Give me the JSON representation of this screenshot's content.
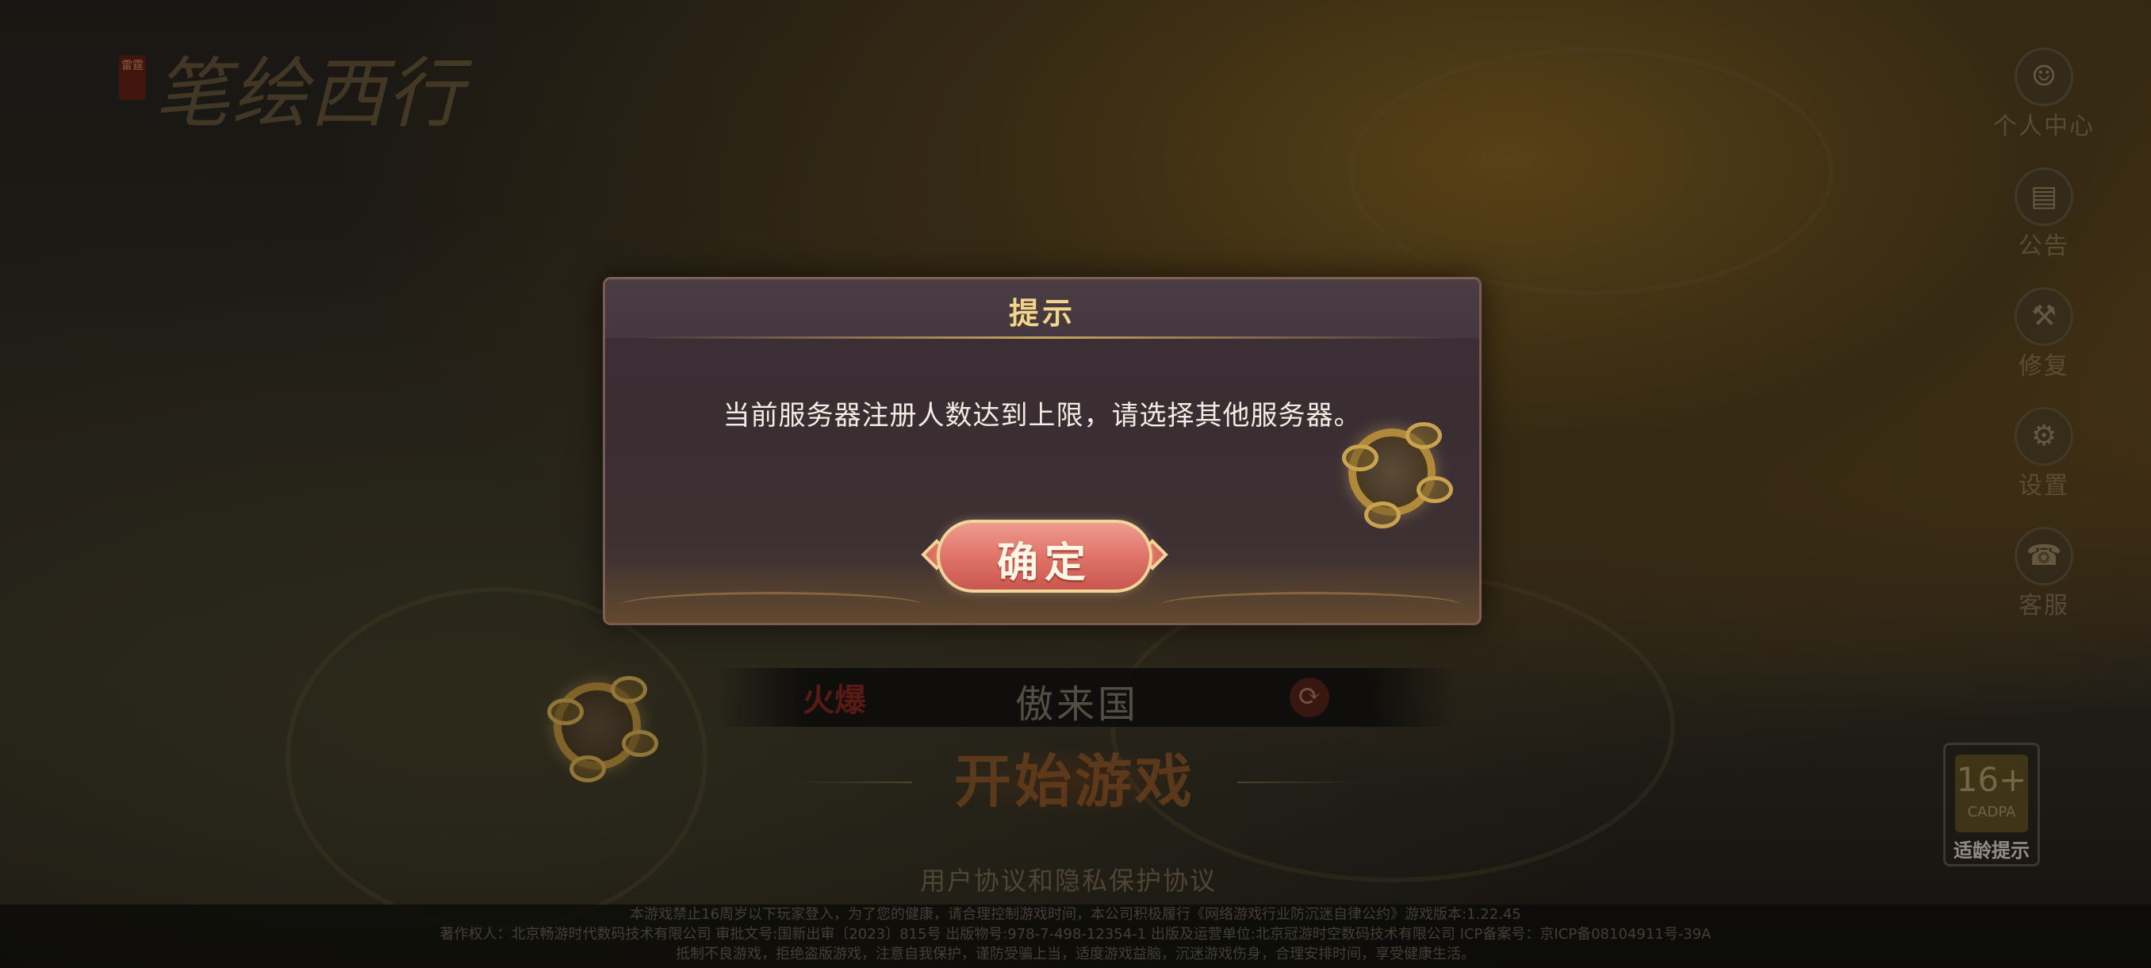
{
  "game": {
    "logo_seal": "雷霆",
    "logo_title": "笔绘西行"
  },
  "sidebar": {
    "items": [
      {
        "label": "个人中心",
        "icon": "user-icon",
        "glyph": "☺"
      },
      {
        "label": "公告",
        "icon": "notice-icon",
        "glyph": "▤"
      },
      {
        "label": "修复",
        "icon": "repair-icon",
        "glyph": "⚒"
      },
      {
        "label": "设置",
        "icon": "gear-icon",
        "glyph": "⚙"
      },
      {
        "label": "客服",
        "icon": "service-icon",
        "glyph": "☎"
      }
    ]
  },
  "age_rating": {
    "number": "16+",
    "org": "CADPA",
    "label": "适龄提示"
  },
  "server": {
    "status_tag": "火爆",
    "name": "傲来国"
  },
  "start": {
    "label": "开始游戏"
  },
  "agreement": {
    "text": "用户协议和隐私保护协议"
  },
  "footer": {
    "lines": [
      "本游戏禁止16周岁以下玩家登入，为了您的健康，请合理控制游戏时间，本公司积极履行《网络游戏行业防沉迷自律公约》游戏版本:1.22.45",
      "著作权人：北京畅游时代数码技术有限公司 审批文号:国新出审〔2023〕815号 出版物号:978-7-498-12354-1 出版及运营单位:北京冠游时空数码技术有限公司 ICP备案号：京ICP备08104911号-39A",
      "抵制不良游戏，拒绝盗版游戏，注意自我保护，谨防受骗上当，适度游戏益脑，沉迷游戏伤身，合理安排时间，享受健康生活。"
    ]
  },
  "dialog": {
    "title": "提示",
    "message": "当前服务器注册人数达到上限，请选择其他服务器。",
    "confirm_label": "确定"
  },
  "colors": {
    "dialog_title": "#f2d588",
    "dialog_text": "#f3ece4",
    "confirm_button": "#e0746a",
    "gold_trim": "#f0d59a"
  }
}
